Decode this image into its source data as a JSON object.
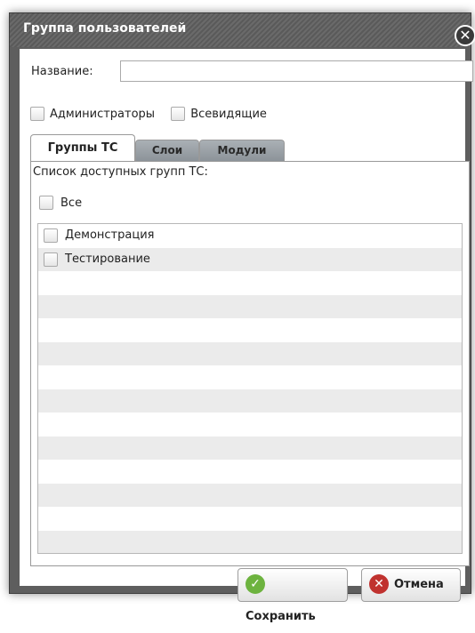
{
  "dialog": {
    "title": "Группа пользователей",
    "name_label": "Название:",
    "name_value": "",
    "name_placeholder": ""
  },
  "roles": [
    {
      "label": "Администраторы",
      "checked": false
    },
    {
      "label": "Всевидящие",
      "checked": false
    }
  ],
  "tabs": [
    {
      "label": "Группы ТС",
      "active": true
    },
    {
      "label": "Слои",
      "active": false
    },
    {
      "label": "Модули",
      "active": false
    }
  ],
  "panel": {
    "caption": "Список доступных групп ТС:",
    "all_label": "Все",
    "groups": [
      {
        "label": "Демонстрация",
        "checked": false
      },
      {
        "label": "Тестирование",
        "checked": false
      }
    ]
  },
  "buttons": {
    "save": "Сохранить",
    "cancel": "Отмена"
  },
  "colors": {
    "titlebar": "#5e5e5e",
    "save_icon": "#6db33f",
    "cancel_icon": "#c0322f"
  },
  "icons": {
    "close": "close-icon",
    "save": "check-circle-icon",
    "cancel": "x-circle-icon"
  }
}
